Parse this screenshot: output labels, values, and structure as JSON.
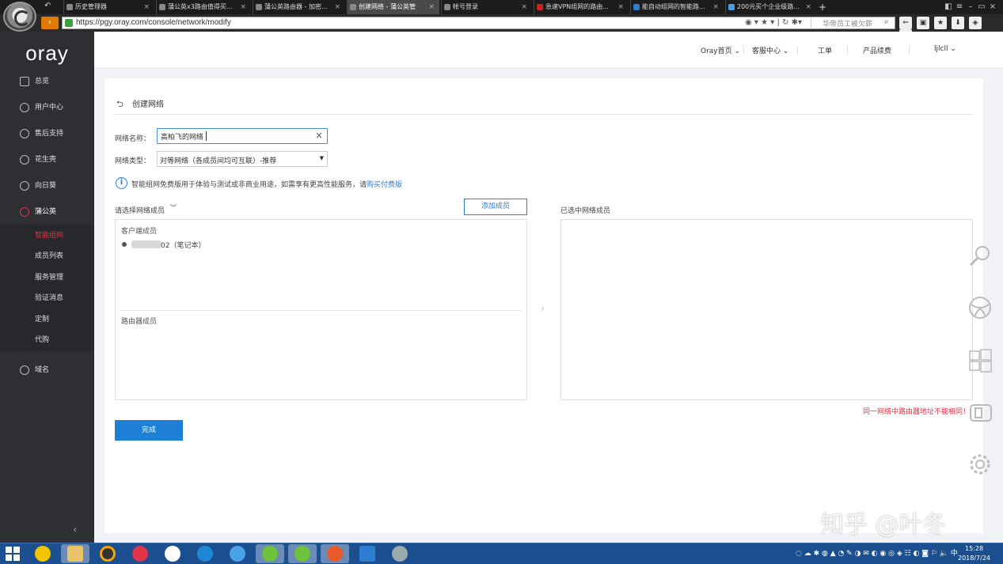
{
  "browser": {
    "tabs": [
      {
        "label": "历史管理器"
      },
      {
        "label": "蒲公英x3路由值得买..."
      },
      {
        "label": "蒲公英路由器 - 加密..."
      },
      {
        "label": "创建网络 - 蒲公英管"
      },
      {
        "label": "帐号登录"
      },
      {
        "label": "急速VPN组网的路由..."
      },
      {
        "label": "能自动组网的智能路..."
      },
      {
        "label": "200元买个企业级路..."
      }
    ],
    "new_tab": "+",
    "url": "https://pgy.oray.com/console/network/modify",
    "search_placeholder": "华帝员工被欠薪"
  },
  "sidebar": {
    "logo": "oray",
    "items": [
      {
        "label": "总览",
        "icon": "grid-icon"
      },
      {
        "label": "用户中心",
        "icon": "user-icon"
      },
      {
        "label": "售后支持",
        "icon": "headset-icon"
      },
      {
        "label": "花生壳",
        "icon": "shell-icon"
      },
      {
        "label": "向日葵",
        "icon": "sunflower-icon"
      },
      {
        "label": "蒲公英",
        "icon": "dandelion-icon"
      }
    ],
    "sub_items": [
      {
        "label": "智能组网",
        "active": true
      },
      {
        "label": "成员列表"
      },
      {
        "label": "服务管理"
      },
      {
        "label": "验证消息"
      },
      {
        "label": "定制"
      },
      {
        "label": "代购"
      }
    ],
    "domain_item": {
      "label": "域名",
      "icon": "www-icon"
    },
    "collapse": "‹"
  },
  "topnav": {
    "home": "Oray首页",
    "service": "客服中心",
    "ticket": "工单",
    "renew": "产品续费",
    "user": "ljlcll"
  },
  "form": {
    "title": "创建网络",
    "name_label": "网络名称：",
    "name_value": "高柏飞的网络",
    "type_label": "网络类型：",
    "type_value": "对等网络（各成员间均可互联）-推荐",
    "info_text": "智能组网免费版用于体验与测试或非商业用途，如需享有更高性能服务，请",
    "info_link": "购买付费版",
    "choose_label": "请选择网络成员",
    "add_member": "添加成员",
    "selected_label": "已选中网络成员",
    "client_title": "客户端成员",
    "member_text": "02（笔记本）",
    "router_title": "路由器成员",
    "error_text": "同一网络中路由器地址不能相同！",
    "done": "完成"
  },
  "watermark": "知乎 @叶冬",
  "taskbar": {
    "tray_lang": "中",
    "time": "15:28",
    "date": "2018/7/24"
  },
  "colors": {
    "accent": "#1e7fd6",
    "active_red": "#e0344a",
    "sidebar_bg": "#2d2f33",
    "taskbar_bg": "#1c4f8f"
  }
}
